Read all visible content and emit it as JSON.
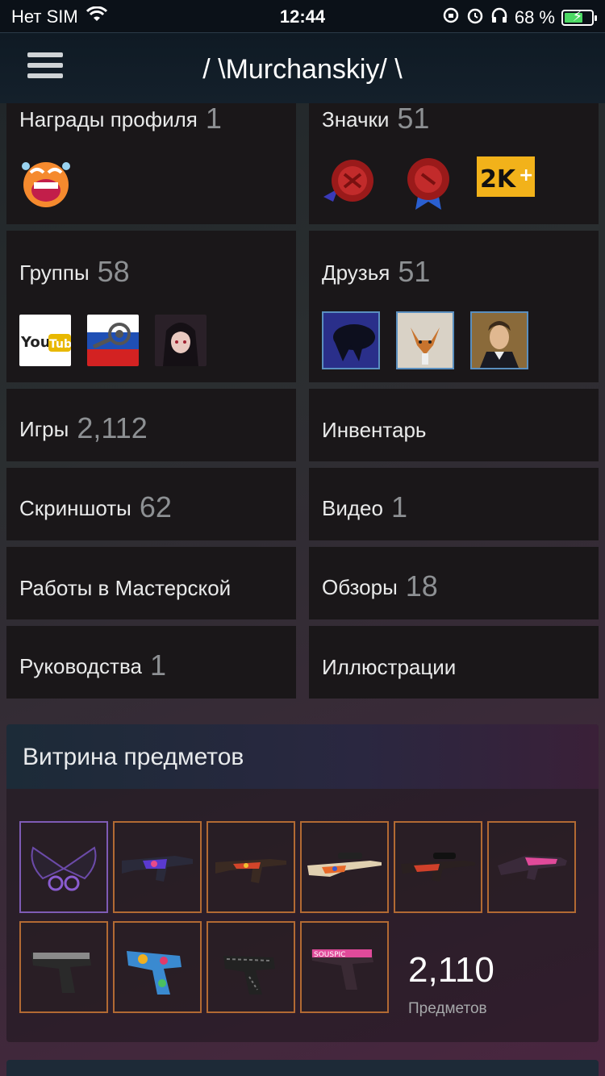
{
  "status_bar": {
    "carrier": "Нет SIM",
    "time": "12:44",
    "battery_percent": "68 %",
    "battery_level": 0.68
  },
  "header": {
    "title": "/ \\Murchanskiy/ \\"
  },
  "tiles": {
    "awards": {
      "label": "Награды профиля",
      "count": "1"
    },
    "badges": {
      "label": "Значки",
      "count": "51"
    },
    "groups": {
      "label": "Группы",
      "count": "58"
    },
    "friends": {
      "label": "Друзья",
      "count": "51"
    },
    "games": {
      "label": "Игры",
      "count": "2,112"
    },
    "inventory": {
      "label": "Инвентарь"
    },
    "screenshots": {
      "label": "Скриншоты",
      "count": "62"
    },
    "videos": {
      "label": "Видео",
      "count": "1"
    },
    "workshop": {
      "label": "Работы в Мастерской"
    },
    "reviews": {
      "label": "Обзоры",
      "count": "18"
    },
    "guides": {
      "label": "Руководства",
      "count": "1"
    },
    "artwork": {
      "label": "Иллюстрации"
    }
  },
  "showcase": {
    "title": "Витрина предметов",
    "item_count": "2,110",
    "item_count_label": "Предметов"
  },
  "colors": {
    "accent_orange_border": "#b26a33",
    "accent_purple_border": "#7e5bb5",
    "friend_border": "#5a8fbf",
    "count_gray": "#8d9093"
  }
}
